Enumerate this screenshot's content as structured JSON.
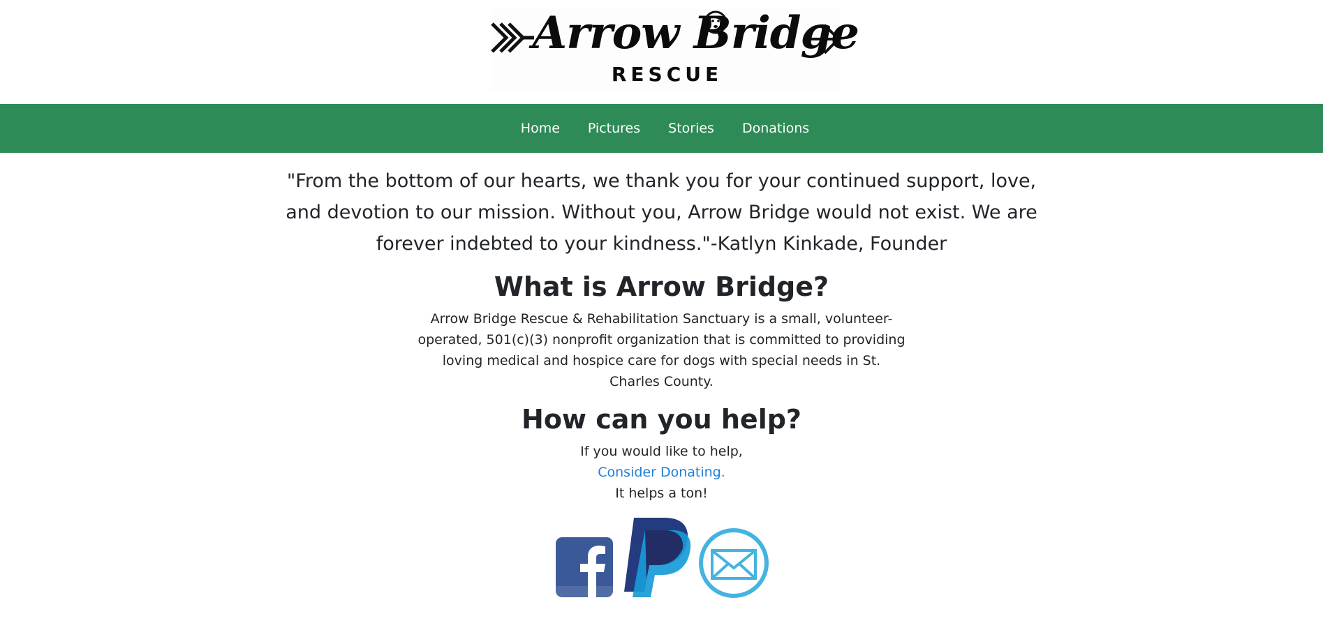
{
  "brand": {
    "logo_script_text": "Arrow Bridge",
    "logo_sub_text": "RESCUE"
  },
  "nav": {
    "items": [
      {
        "label": "Home"
      },
      {
        "label": "Pictures"
      },
      {
        "label": "Stories"
      },
      {
        "label": "Donations"
      }
    ]
  },
  "quote": {
    "text": "\"From the bottom of our hearts, we thank you for your continued support, love, and devotion to our mission. Without you, Arrow Bridge would not exist. We are forever indebted to your kindness.\"-Katlyn Kinkade, Founder"
  },
  "about": {
    "heading": "What is Arrow Bridge?",
    "body": "Arrow Bridge Rescue & Rehabilitation Sanctuary is a small, volunteer-operated, 501(c)(3) nonprofit organization that is committed to providing loving medical and hospice care for dogs with special needs in St. Charles County."
  },
  "help": {
    "heading": "How can you help?",
    "line1": "If you would like to help,",
    "link": "Consider Donating.",
    "line3": "It helps a ton!"
  },
  "social": {
    "icons": [
      "facebook-icon",
      "paypal-icon",
      "email-icon"
    ]
  },
  "colors": {
    "nav_bg": "#2e8b57",
    "link": "#1f7fd6",
    "text": "#212529"
  }
}
